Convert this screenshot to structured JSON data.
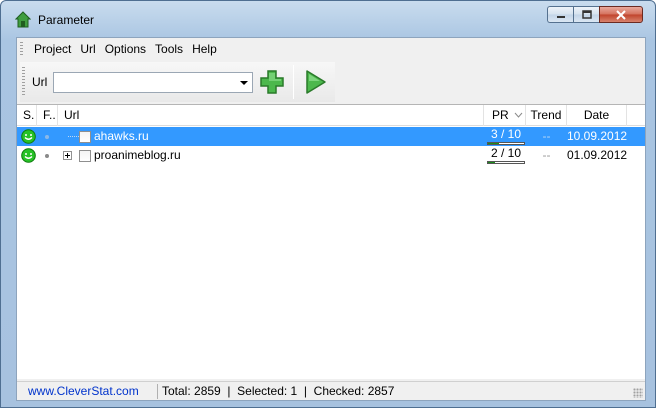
{
  "window": {
    "title": "Parameter"
  },
  "menu": {
    "items": [
      "Project",
      "Url",
      "Options",
      "Tools",
      "Help"
    ]
  },
  "toolbar": {
    "url_label": "Url",
    "url_value": "",
    "add_icon": "plus-icon",
    "run_icon": "play-icon"
  },
  "grid": {
    "columns": [
      "S.",
      "F..",
      "Url",
      "PR",
      "Trend",
      "Date"
    ],
    "rows": [
      {
        "url": "ahawks.ru",
        "pr": "3 / 10",
        "pr_fraction": 0.3,
        "trend": "--",
        "date": "10.09.2012",
        "selected": true
      },
      {
        "url": "proanimeblog.ru",
        "pr": "2 / 10",
        "pr_fraction": 0.2,
        "trend": "--",
        "date": "01.09.2012",
        "selected": false
      }
    ]
  },
  "statusbar": {
    "link": "www.CleverStat.com",
    "text": "Total: 2859  |  Selected: 1  |  Checked: 2857"
  },
  "colors": {
    "selection": "#3399ff",
    "link": "#0033cc",
    "accent_green": "#3cb43c"
  }
}
